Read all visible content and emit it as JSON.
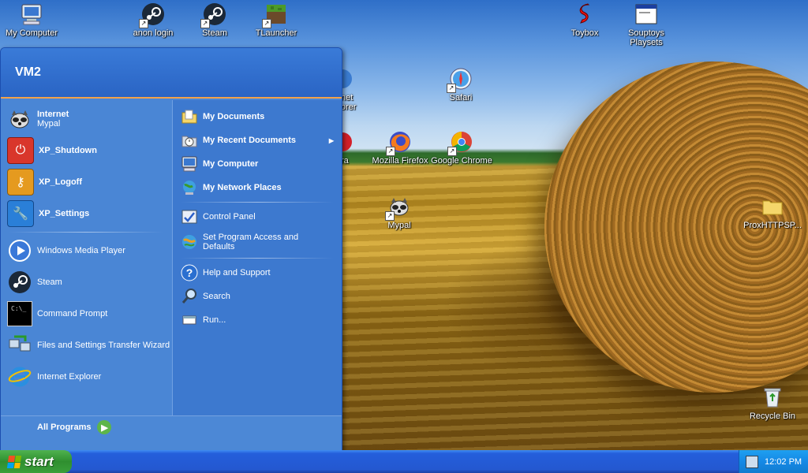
{
  "desktop": {
    "icons": [
      {
        "label": "My Computer",
        "name": "my-computer-icon",
        "shortcut": false
      },
      {
        "label": "anon login",
        "name": "anon-login-icon",
        "shortcut": true
      },
      {
        "label": "Steam",
        "name": "steam-icon",
        "shortcut": true
      },
      {
        "label": "TLauncher",
        "name": "tlauncher-icon",
        "shortcut": true
      },
      {
        "label": "Toybox",
        "name": "toybox-icon",
        "shortcut": false
      },
      {
        "label": "Souptoys Playsets",
        "name": "souptoys-playsets-icon",
        "shortcut": false
      },
      {
        "label": "Safari",
        "name": "safari-icon",
        "shortcut": true
      },
      {
        "label": "Mozilla Firefox",
        "name": "firefox-icon",
        "shortcut": true
      },
      {
        "label": "Google Chrome",
        "name": "chrome-icon",
        "shortcut": true
      },
      {
        "label": "Mypal",
        "name": "mypal-icon",
        "shortcut": true
      },
      {
        "label": "ProxHTTPSP...",
        "name": "folder-icon",
        "shortcut": false
      },
      {
        "label": "Recycle Bin",
        "name": "recycle-bin-icon",
        "shortcut": false
      },
      {
        "label": "net",
        "name": "partial-icon-net"
      },
      {
        "label": "orer",
        "name": "partial-icon-orer"
      },
      {
        "label": "ra",
        "name": "partial-icon-ra"
      }
    ]
  },
  "start_menu": {
    "user": "VM2",
    "pinned": [
      {
        "title": "Internet",
        "subtitle": "Mypal",
        "icon": "mypal-icon"
      },
      {
        "title": "XP_Shutdown",
        "icon": "power-icon"
      },
      {
        "title": "XP_Logoff",
        "icon": "key-icon"
      },
      {
        "title": "XP_Settings",
        "icon": "wrench-icon"
      }
    ],
    "recent": [
      {
        "label": "Windows Media Player",
        "icon": "media-player-icon"
      },
      {
        "label": "Steam",
        "icon": "steam-icon"
      },
      {
        "label": "Command Prompt",
        "icon": "command-prompt-icon"
      },
      {
        "label": "Files and Settings Transfer Wizard",
        "icon": "transfer-wizard-icon"
      },
      {
        "label": "Internet Explorer",
        "icon": "internet-explorer-icon"
      }
    ],
    "all_programs": "All Programs",
    "right": [
      {
        "label": "My Documents",
        "icon": "documents-icon",
        "bold": true
      },
      {
        "label": "My Recent Documents",
        "icon": "recent-documents-icon",
        "bold": true,
        "submenu": true
      },
      {
        "label": "My Computer",
        "icon": "computer-icon",
        "bold": true
      },
      {
        "label": "My Network Places",
        "icon": "network-icon",
        "bold": true
      },
      {
        "label": "Control Panel",
        "icon": "control-panel-icon"
      },
      {
        "label": "Set Program Access and Defaults",
        "icon": "program-access-icon"
      },
      {
        "label": "Help and Support",
        "icon": "help-icon"
      },
      {
        "label": "Search",
        "icon": "search-icon"
      },
      {
        "label": "Run...",
        "icon": "run-icon"
      }
    ]
  },
  "taskbar": {
    "start_label": "start",
    "clock": "12:02 PM"
  }
}
